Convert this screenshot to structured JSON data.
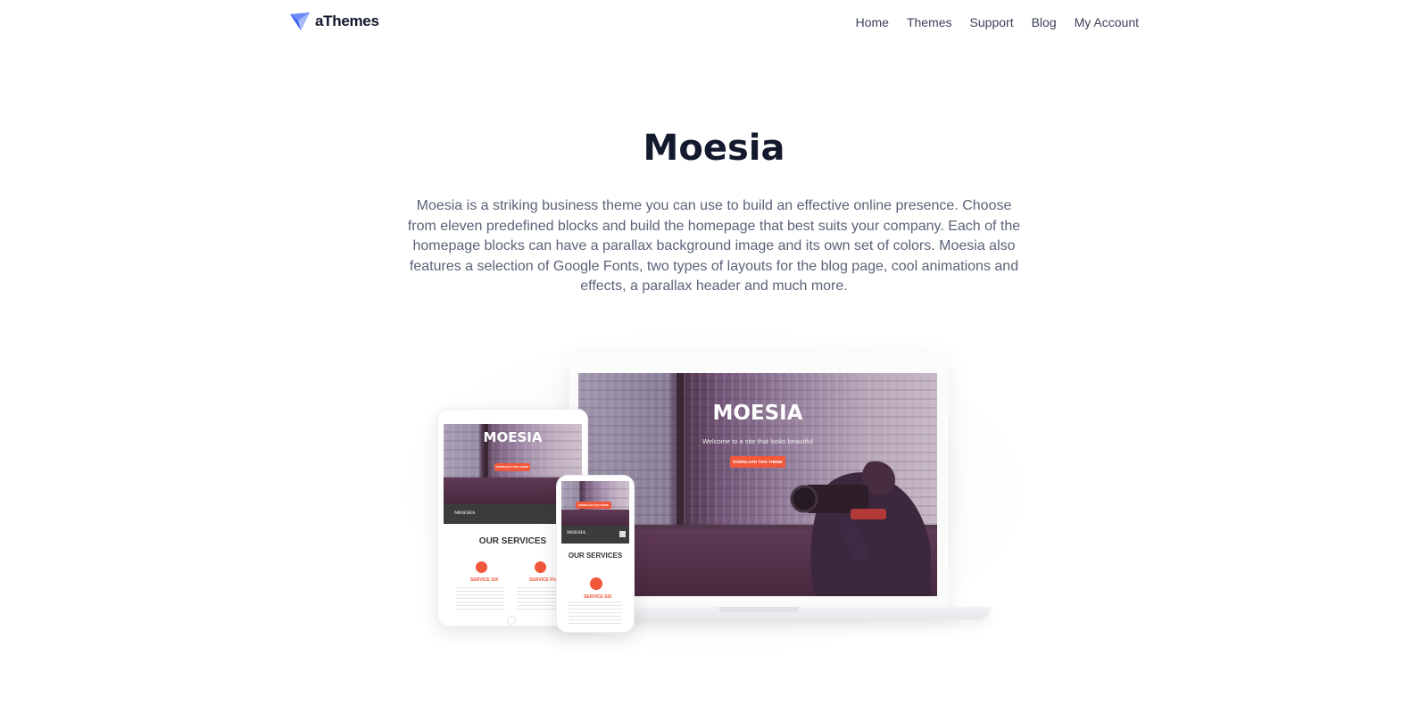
{
  "header": {
    "logo_text": "aThemes",
    "nav": [
      "Home",
      "Themes",
      "Support",
      "Blog",
      "My Account"
    ]
  },
  "hero": {
    "title": "Moesia",
    "description": "Moesia is a striking business theme you can use to build an effective online presence. Choose from eleven predefined blocks and build the homepage that best suits your company. Each of the homepage blocks can have a parallax background image and its own set of colors. Moesia also features a selection of Google Fonts, two types of layouts for the blog page, cool animations and effects, a parallax header and much more."
  },
  "mockup": {
    "laptop": {
      "site_title": "MOESIA",
      "tagline": "Welcome to a site that looks beautiful",
      "button": "DOWNLOAD THIS THEME"
    },
    "tablet": {
      "site_title": "MOESIA",
      "button": "DOWNLOAD THIS THEME",
      "nav_brand": "MOESIA",
      "services_heading": "OUR SERVICES",
      "service_left": "SERVICE SIX",
      "service_right": "SERVICE FIVE"
    },
    "phone": {
      "button": "DOWNLOAD THIS THEME",
      "nav_brand": "MOESIA",
      "services_heading": "OUR SERVICES",
      "service": "SERVICE SIX"
    }
  },
  "colors": {
    "accent": "#f0573b",
    "logo_blue": "#3b63f0",
    "title": "#141a2e",
    "body_text": "#5b6378"
  }
}
